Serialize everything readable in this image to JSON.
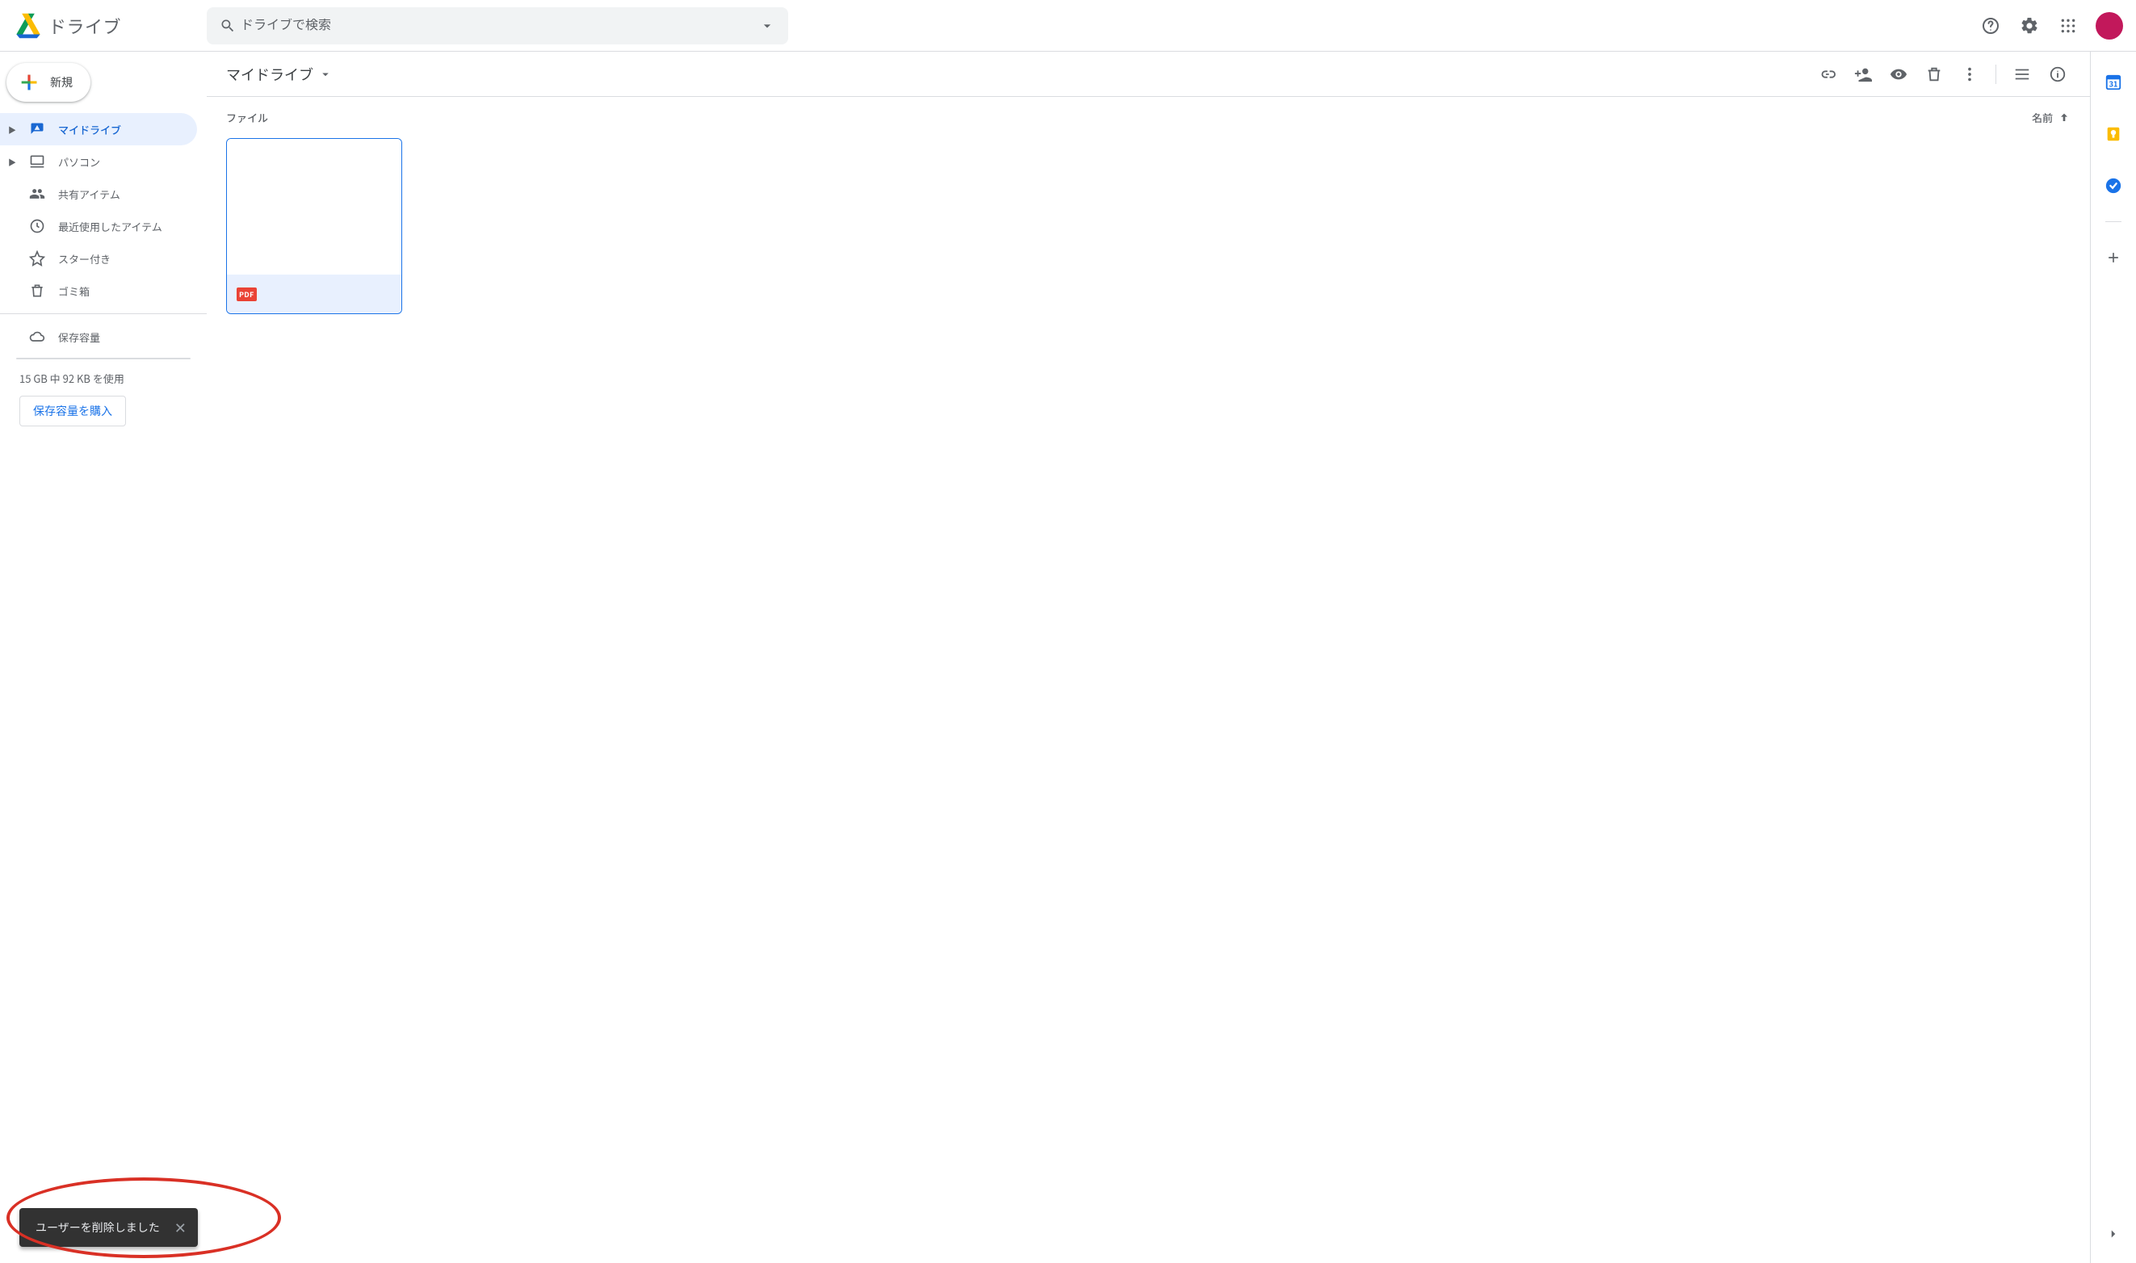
{
  "app": {
    "name": "ドライブ"
  },
  "search": {
    "placeholder": "ドライブで検索"
  },
  "new_button": {
    "label": "新規"
  },
  "sidebar": {
    "items": [
      {
        "label": "マイドライブ",
        "has_caret": true,
        "active": true
      },
      {
        "label": "パソコン",
        "has_caret": true
      },
      {
        "label": "共有アイテム"
      },
      {
        "label": "最近使用したアイテム"
      },
      {
        "label": "スター付き"
      },
      {
        "label": "ゴミ箱"
      }
    ],
    "storage_item": {
      "label": "保存容量"
    },
    "storage_text": "15 GB 中 92 KB を使用",
    "buy_storage": "保存容量を購入"
  },
  "breadcrumb": {
    "title": "マイドライブ"
  },
  "section": {
    "files_label": "ファイル"
  },
  "sort": {
    "label": "名前"
  },
  "file": {
    "type_badge": "PDF"
  },
  "toast": {
    "message": "ユーザーを削除しました"
  }
}
